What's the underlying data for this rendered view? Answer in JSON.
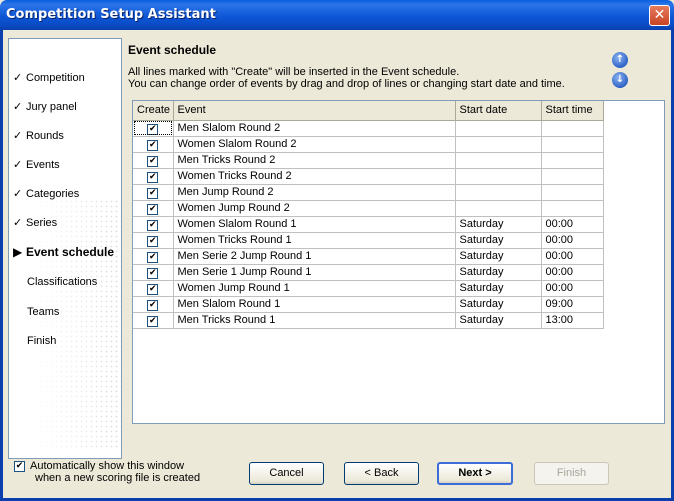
{
  "window": {
    "title": "Competition Setup Assistant",
    "close_glyph": "✕"
  },
  "sidebar": {
    "items": [
      {
        "label": "Competition",
        "mark": "✓",
        "state": "done"
      },
      {
        "label": "Jury panel",
        "mark": "✓",
        "state": "done"
      },
      {
        "label": "Rounds",
        "mark": "✓",
        "state": "done"
      },
      {
        "label": "Events",
        "mark": "✓",
        "state": "done"
      },
      {
        "label": "Categories",
        "mark": "✓",
        "state": "done"
      },
      {
        "label": "Series",
        "mark": "✓",
        "state": "done"
      },
      {
        "label": "Event schedule",
        "mark": "▶",
        "state": "active"
      },
      {
        "label": "Classifications",
        "mark": "",
        "state": "pending"
      },
      {
        "label": "Teams",
        "mark": "",
        "state": "pending"
      },
      {
        "label": "Finish",
        "mark": "",
        "state": "pending"
      }
    ]
  },
  "main": {
    "heading": "Event schedule",
    "desc_line1": "All lines marked with \"Create\" will be inserted in the Event schedule.",
    "desc_line2": "You can change order of events by drag and drop of lines or changing start date and time.",
    "move_up_glyph": "↑",
    "move_down_glyph": "↓"
  },
  "grid": {
    "headers": {
      "create": "Create",
      "event": "Event",
      "start_date": "Start date",
      "start_time": "Start time"
    },
    "rows": [
      {
        "create": true,
        "event": "Men Slalom Round 2",
        "date": "",
        "time": ""
      },
      {
        "create": true,
        "event": "Women Slalom Round 2",
        "date": "",
        "time": ""
      },
      {
        "create": true,
        "event": "Men Tricks Round 2",
        "date": "",
        "time": ""
      },
      {
        "create": true,
        "event": "Women Tricks Round 2",
        "date": "",
        "time": ""
      },
      {
        "create": true,
        "event": "Men Jump Round 2",
        "date": "",
        "time": ""
      },
      {
        "create": true,
        "event": "Women Jump Round 2",
        "date": "",
        "time": ""
      },
      {
        "create": true,
        "event": "Women Slalom Round 1",
        "date": "Saturday",
        "time": "00:00"
      },
      {
        "create": true,
        "event": "Women Tricks Round 1",
        "date": "Saturday",
        "time": "00:00"
      },
      {
        "create": true,
        "event": "Men Serie 2 Jump Round 1",
        "date": "Saturday",
        "time": "00:00"
      },
      {
        "create": true,
        "event": "Men Serie 1 Jump Round 1",
        "date": "Saturday",
        "time": "00:00"
      },
      {
        "create": true,
        "event": "Women Jump Round 1",
        "date": "Saturday",
        "time": "00:00"
      },
      {
        "create": true,
        "event": "Men Slalom Round 1",
        "date": "Saturday",
        "time": "09:00"
      },
      {
        "create": true,
        "event": "Men Tricks Round 1",
        "date": "Saturday",
        "time": "13:00"
      }
    ]
  },
  "footer": {
    "auto_show_checked": true,
    "auto_show_line1": "Automatically show this window",
    "auto_show_line2": "when a new scoring file is created",
    "cancel": "Cancel",
    "back": "< Back",
    "next": "Next >",
    "finish": "Finish"
  },
  "colors": {
    "titlebar": "#0a4bc4",
    "close": "#c94424",
    "window_bg": "#ece9d8",
    "border": "#7f9db9"
  }
}
